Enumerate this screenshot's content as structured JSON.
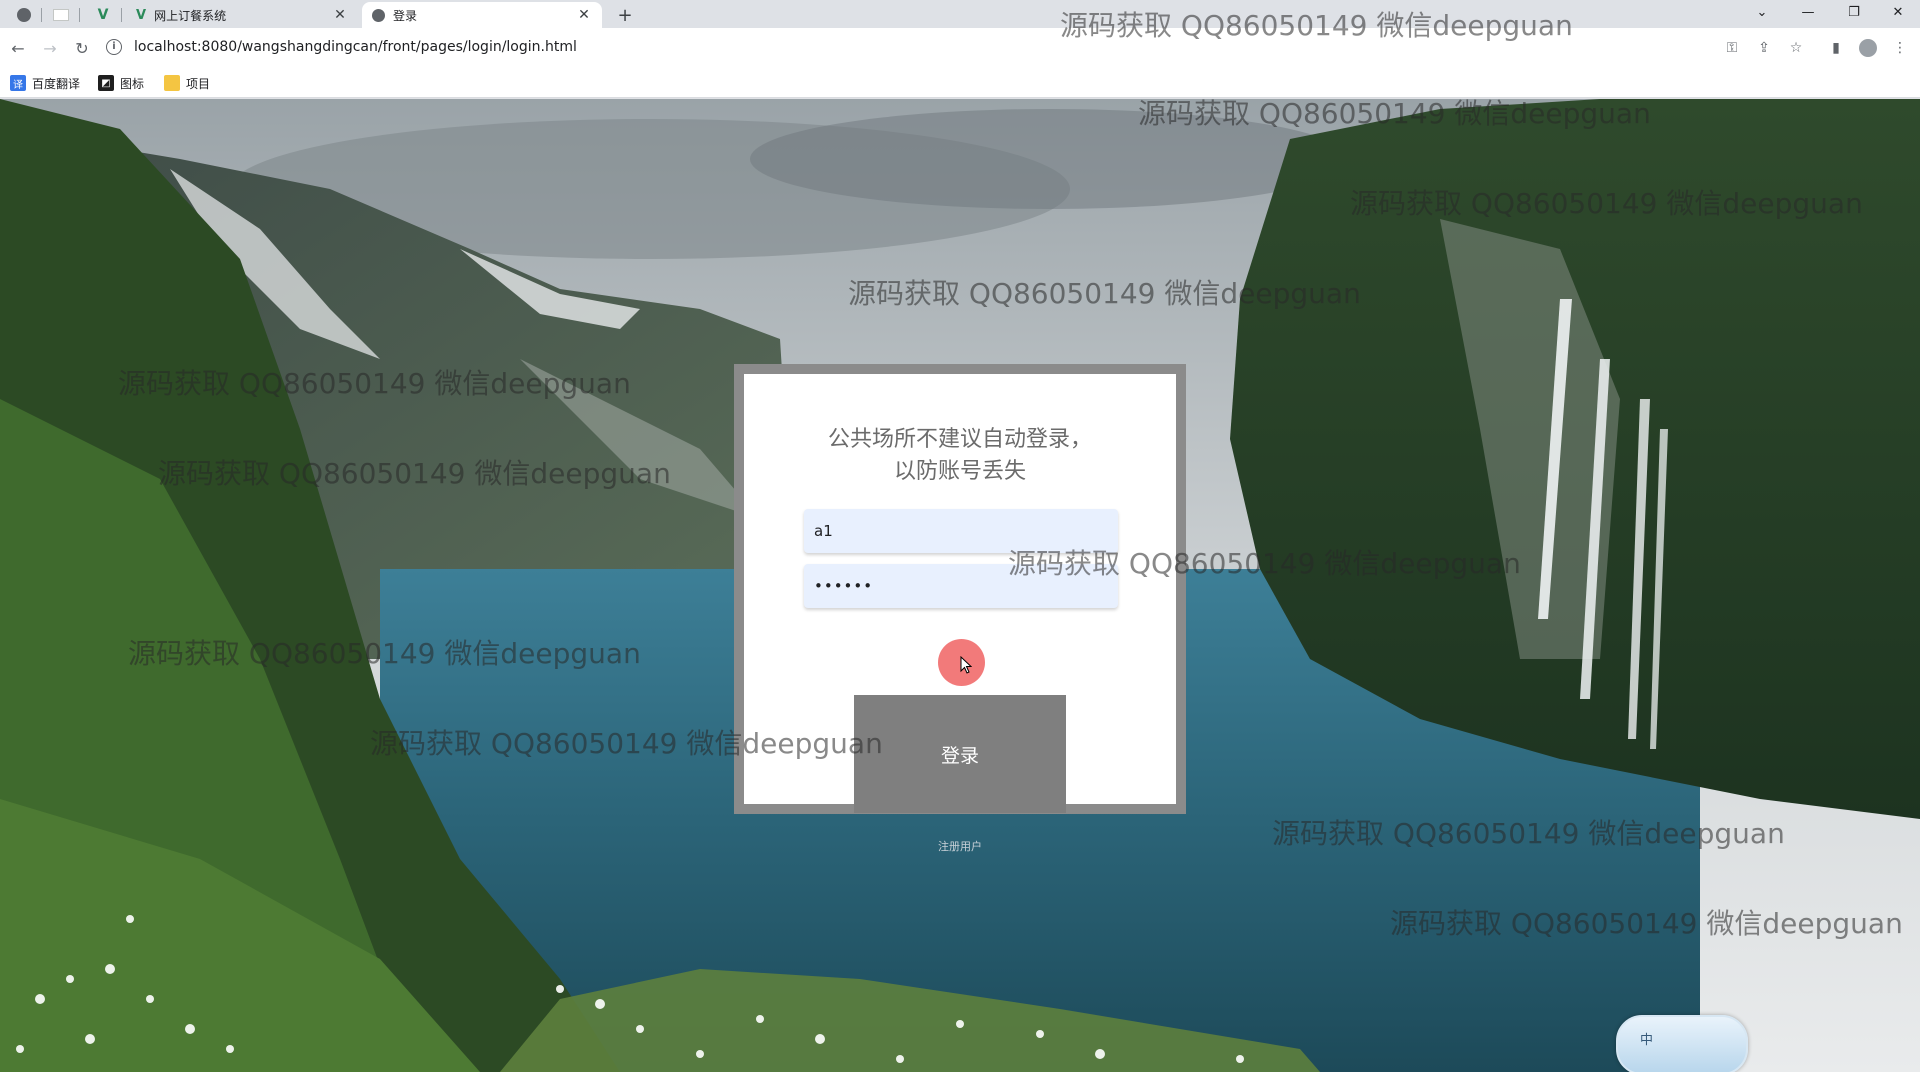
{
  "browser": {
    "tabs": [
      {
        "title": "网上订餐系统",
        "active": false
      },
      {
        "title": "登录",
        "active": true
      }
    ],
    "url": "localhost:8080/wangshangdingcan/front/pages/login/login.html",
    "bookmarks": [
      "百度翻译",
      "图标",
      "项目"
    ]
  },
  "login": {
    "tip_line1": "公共场所不建议自动登录，",
    "tip_line2": "以防账号丢失",
    "username": "a1",
    "password_mask": "••••••",
    "button_label": "登录",
    "register_link": "注册用户"
  },
  "watermark": "源码获取 QQ86050149 微信deepguan",
  "ime_label": "中",
  "colors": {
    "dialog_frame": "#8b8b8b",
    "login_button": "#7f7f7f",
    "input_bg": "#e8f0fe",
    "click_indicator": "#f16b6b"
  }
}
